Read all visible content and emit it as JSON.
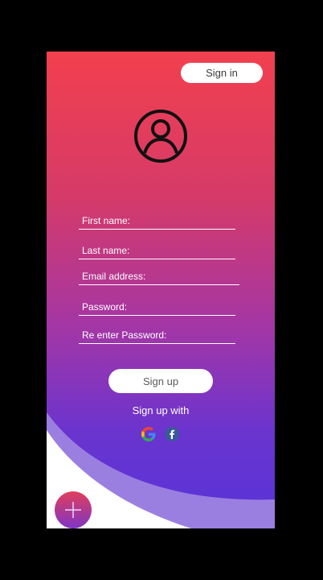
{
  "header": {
    "sign_in_label": "Sign in"
  },
  "form": {
    "fields": [
      {
        "label": "First name:"
      },
      {
        "label": "Last name:"
      },
      {
        "label": "Email address:"
      },
      {
        "label": "Password:"
      },
      {
        "label": "Re enter Password:"
      }
    ],
    "sign_up_label": "Sign up",
    "sign_up_with_label": "Sign up with"
  },
  "social": {
    "google_icon": "google-icon",
    "facebook_icon": "facebook-icon"
  },
  "colors": {
    "gradient_top": "#f2404e",
    "gradient_bottom": "#5733d8",
    "wave": "#9b7fe0",
    "white": "#ffffff"
  }
}
